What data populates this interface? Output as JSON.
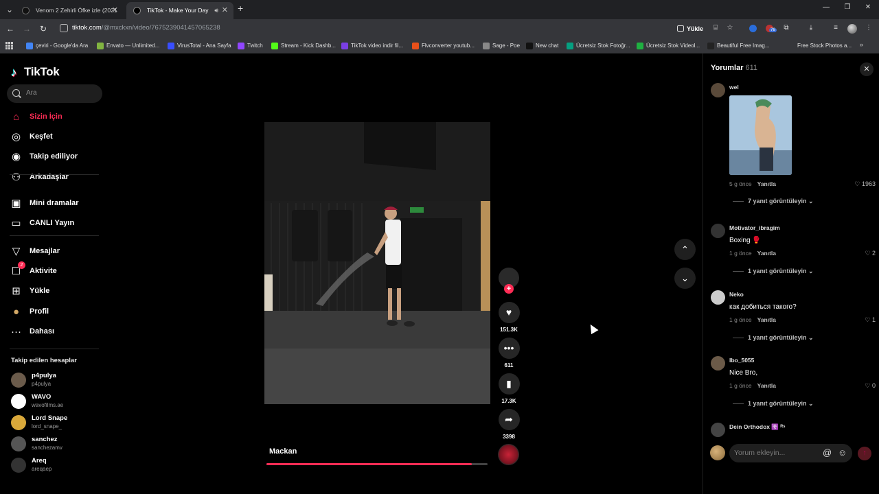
{
  "browser": {
    "tabs": [
      {
        "title": "Venom 2 Zehirli Öfke izle (2021",
        "active": false
      },
      {
        "title": "TikTok - Make Your Day",
        "active": true
      }
    ],
    "url": {
      "host": "tiktok.com",
      "path": "/@mxckxn/video/7675239041457065238"
    },
    "yukle_label": "Yükle",
    "extension_badge": "76",
    "bookmarks": [
      {
        "label": "çeviri - Google'da Ara",
        "color": "#4285f4"
      },
      {
        "label": "Envato — Unlimited...",
        "color": "#82b541"
      },
      {
        "label": "VirusTotal - Ana Sayfa",
        "color": "#394eff"
      },
      {
        "label": "Twitch",
        "color": "#9146ff"
      },
      {
        "label": "Stream - Kick Dashb...",
        "color": "#53fc18"
      },
      {
        "label": "TikTok video indir fil...",
        "color": "#7b3fe4"
      },
      {
        "label": "Flvconverter youtub...",
        "color": "#e8501a"
      },
      {
        "label": "Sage - Poe",
        "color": "#888888"
      },
      {
        "label": "New chat",
        "color": "#111111"
      },
      {
        "label": "Ücretsiz Stok Fotoğr...",
        "color": "#05a081"
      },
      {
        "label": "Ücretsiz Stok Videol...",
        "color": "#1fb141"
      },
      {
        "label": "Beautiful Free Imag...",
        "color": "#222222"
      },
      {
        "label": "Free Stock Photos a...",
        "color": "#35363a"
      }
    ]
  },
  "tiktok": {
    "brand": "TikTok",
    "search_placeholder": "Ara",
    "nav": [
      {
        "label": "Sizin İçin",
        "icon": "home-icon",
        "glyph": "⌂",
        "active": true
      },
      {
        "label": "Keşfet",
        "icon": "compass-icon",
        "glyph": "◎"
      },
      {
        "label": "Takip ediliyor",
        "icon": "following-icon",
        "glyph": "◉"
      },
      {
        "label": "Arkadaşlar",
        "icon": "friends-icon",
        "glyph": "⚇"
      },
      {
        "label": "Mini dramalar",
        "icon": "drama-icon",
        "glyph": "▣"
      },
      {
        "label": "CANLI Yayın",
        "icon": "live-icon",
        "glyph": "▭"
      },
      {
        "label": "Mesajlar",
        "icon": "messages-icon",
        "glyph": "▽"
      },
      {
        "label": "Aktivite",
        "icon": "activity-icon",
        "glyph": "☐",
        "badge": "2"
      },
      {
        "label": "Yükle",
        "icon": "upload-icon",
        "glyph": "⊞"
      },
      {
        "label": "Profil",
        "icon": "profile-icon",
        "glyph": "●"
      },
      {
        "label": "Dahası",
        "icon": "more-icon",
        "glyph": "···"
      }
    ],
    "following_header": "Takip edilen hesaplar",
    "following": [
      {
        "name": "p4pulya",
        "handle": "p4pulya",
        "color": "#6b5b4b"
      },
      {
        "name": "WAVO",
        "handle": "wavofilms.ae",
        "color": "#ffffff"
      },
      {
        "name": "Lord Snape",
        "handle": "lord_snape_",
        "color": "#d9a83a"
      },
      {
        "name": "sanchez",
        "handle": "sanchezamv",
        "color": "#555555"
      },
      {
        "name": "Areq",
        "handle": "areqaep",
        "color": "#333333"
      }
    ],
    "video": {
      "caption": "Mackan",
      "progress": 0.93,
      "likes": "151.3K",
      "comments": "611",
      "saves": "17.3K",
      "shares": "3398"
    },
    "comments_panel": {
      "title": "Yorumlar",
      "count": "611",
      "input_placeholder": "Yorum ekleyin...",
      "items": [
        {
          "user": "wel",
          "text": "",
          "time": "5 g önce",
          "reply": "Yanıtla",
          "likes": "1963",
          "view_replies": "7 yanıt görüntüleyin",
          "has_image": true,
          "avatar": "#5a4a3a"
        },
        {
          "user": "Motivator_ibragim",
          "text": "Boxing 🥊",
          "time": "1 g önce",
          "reply": "Yanıtla",
          "likes": "2",
          "view_replies": "1 yanıt görüntüleyin",
          "avatar": "#333333"
        },
        {
          "user": "Neko",
          "text": "как добиться такого?",
          "time": "1 g önce",
          "reply": "Yanıtla",
          "likes": "1",
          "view_replies": "1 yanıt görüntüleyin",
          "avatar": "#cccccc"
        },
        {
          "user": "Ibo_5055",
          "text": "Nice Bro,",
          "time": "1 g önce",
          "reply": "Yanıtla",
          "likes": "0",
          "view_replies": "1 yanıt görüntüleyin",
          "avatar": "#6b5a48"
        },
        {
          "user": "Dein Orthodox ☦️ ᴿˢ",
          "text": "",
          "time": "",
          "reply": "",
          "likes": "",
          "view_replies": "",
          "avatar": "#444444"
        }
      ]
    }
  }
}
